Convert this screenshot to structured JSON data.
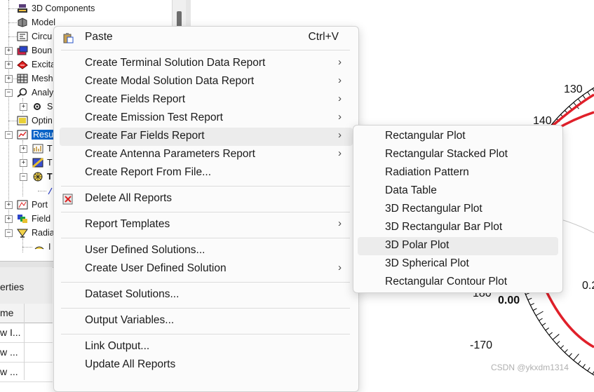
{
  "tree": {
    "items": [
      {
        "label": "3D Components",
        "icon": "components-icon"
      },
      {
        "label": "Model",
        "icon": "model-icon"
      },
      {
        "label": "Circu",
        "icon": "circuit-icon"
      },
      {
        "label": "Boun",
        "icon": "boundary-icon"
      },
      {
        "label": "Excita",
        "icon": "excitation-icon"
      },
      {
        "label": "Mesh",
        "icon": "mesh-icon"
      },
      {
        "label": "Analy",
        "icon": "analysis-icon"
      },
      {
        "label": "S",
        "icon": "setup-icon"
      },
      {
        "label": "Optin",
        "icon": "optimetrics-icon"
      },
      {
        "label": "Resu",
        "icon": "results-icon"
      },
      {
        "label": "T",
        "icon": "report-icon"
      },
      {
        "label": "T",
        "icon": "report-icon"
      },
      {
        "label": "T",
        "icon": "radiation-report-icon"
      },
      {
        "label": "",
        "icon": "trace-icon"
      },
      {
        "label": "Port",
        "icon": "port-icon"
      },
      {
        "label": "Field",
        "icon": "field-icon"
      },
      {
        "label": "Radia",
        "icon": "radiation-icon"
      },
      {
        "label": "I",
        "icon": "infinite-sphere-icon"
      }
    ]
  },
  "properties": {
    "title": "erties",
    "header": "me",
    "rows": [
      "w I...",
      "w ...",
      "w ..."
    ]
  },
  "context_menu": {
    "paste": {
      "label": "Paste",
      "shortcut": "Ctrl+V"
    },
    "items": [
      {
        "label": "Create Terminal Solution Data Report",
        "submenu": true
      },
      {
        "label": "Create Modal Solution Data Report",
        "submenu": true
      },
      {
        "label": "Create Fields Report",
        "submenu": true
      },
      {
        "label": "Create Emission Test Report",
        "submenu": true
      },
      {
        "label": "Create Far Fields Report",
        "submenu": true
      },
      {
        "label": "Create Antenna Parameters Report",
        "submenu": true
      },
      {
        "label": "Create Report From File...",
        "submenu": false
      }
    ],
    "delete_all": "Delete All Reports",
    "report_templates": "Report Templates",
    "user_defined_solutions": "User Defined Solutions...",
    "create_user_defined_solution": "Create User Defined Solution",
    "dataset_solutions": "Dataset Solutions...",
    "output_variables": "Output Variables...",
    "link_output": "Link Output...",
    "update_all_reports": "Update All Reports",
    "arrow_glyph": "›"
  },
  "far_fields_submenu": {
    "items": [
      "Rectangular Plot",
      "Rectangular Stacked Plot",
      "Radiation Pattern",
      "Data Table",
      "3D Rectangular Plot",
      "3D Rectangular Bar Plot",
      "3D Polar Plot",
      "3D Spherical Plot",
      "Rectangular Contour Plot"
    ],
    "highlighted": "3D Polar Plot"
  },
  "plot": {
    "labels": {
      "a130": "130",
      "a140": "140",
      "a180": "180",
      "am170": "-170",
      "r000": "0.00",
      "r02": "0.2"
    },
    "trace_color": "#e0202a"
  },
  "watermark": "CSDN @ykxdm1314"
}
